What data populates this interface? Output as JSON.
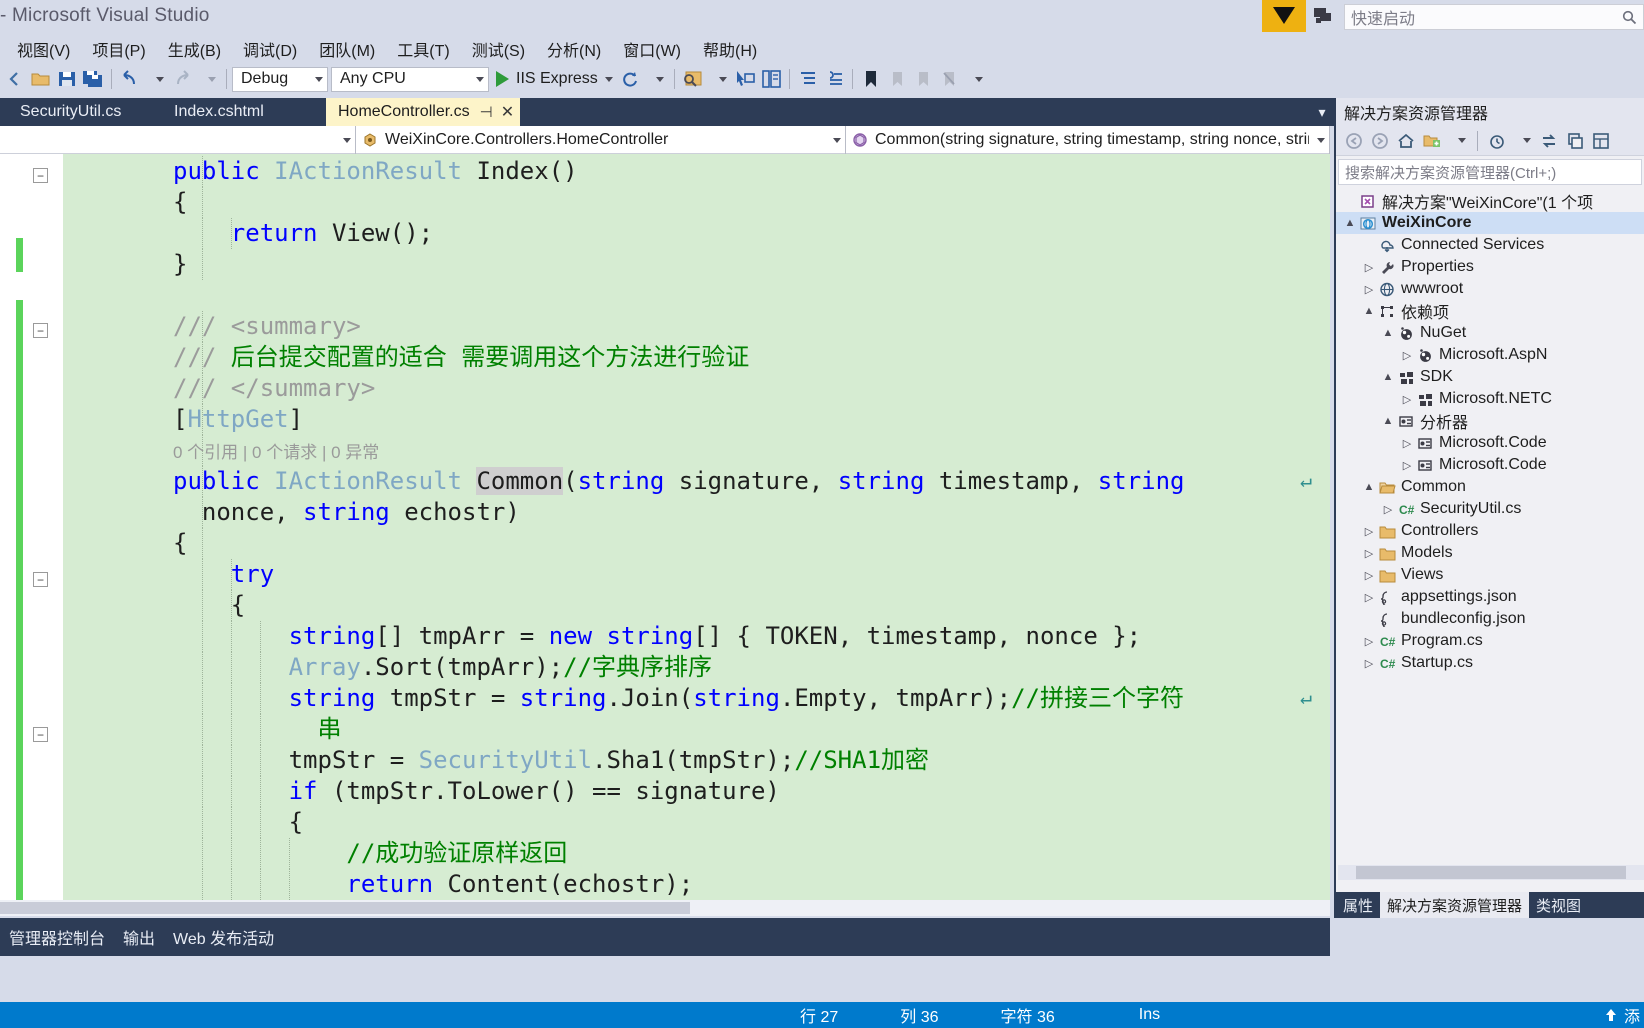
{
  "titlebar": {
    "title": "- Microsoft Visual Studio",
    "feedback_icon": "feedback-funnel-icon",
    "notify_icon": "notification-icon",
    "quick_launch_placeholder": "快速启动",
    "search_icon": "search-icon"
  },
  "menu": {
    "items": [
      {
        "label": "视图(V)"
      },
      {
        "label": "项目(P)"
      },
      {
        "label": "生成(B)"
      },
      {
        "label": "调试(D)"
      },
      {
        "label": "团队(M)"
      },
      {
        "label": "工具(T)"
      },
      {
        "label": "测试(S)"
      },
      {
        "label": "分析(N)"
      },
      {
        "label": "窗口(W)"
      },
      {
        "label": "帮助(H)"
      }
    ]
  },
  "toolbar": {
    "config_value": "Debug",
    "platform_value": "Any CPU",
    "run_label": "IIS Express",
    "icons": [
      "navigate-back-icon",
      "open-folder-icon",
      "save-icon",
      "save-all-icon",
      "undo-icon",
      "redo-icon",
      "refresh-icon",
      "find-icon",
      "folder-search-icon",
      "comment-icon",
      "uncomment-icon",
      "indent-icon",
      "outdent-icon",
      "bookmark-icon",
      "prev-bookmark-icon",
      "next-bookmark-icon",
      "clear-bookmark-icon"
    ]
  },
  "tabs": {
    "items": [
      {
        "label": "SecurityUtil.cs",
        "active": false
      },
      {
        "label": "Index.cshtml",
        "active": false
      },
      {
        "label": "HomeController.cs",
        "active": true
      }
    ],
    "pin_glyph": "⊣",
    "close_glyph": "✕",
    "overflow_glyph": "▾"
  },
  "navbar": {
    "project_value": "",
    "type_value": "WeiXinCore.Controllers.HomeController",
    "member_value": "Common(string signature, string timestamp, string nonce, strin"
  },
  "editor": {
    "lines": [
      {
        "indent": 2,
        "glyph": "-",
        "changed": false,
        "html": "<span class=\"k\">public</span> <span class=\"t\">IActionResult</span> Index()"
      },
      {
        "indent": 2,
        "changed": false,
        "html": "{"
      },
      {
        "indent": 3,
        "changed": false,
        "html": "    <span class=\"k\">return</span> View();"
      },
      {
        "indent": 2,
        "changed": false,
        "html": "}"
      },
      {
        "indent": 0,
        "changed": false,
        "html": ""
      },
      {
        "indent": 2,
        "glyph": "-",
        "changed": false,
        "html": "<span class=\"cg\">/// &lt;summary&gt;</span>"
      },
      {
        "indent": 2,
        "changed": false,
        "html": "<span class=\"cg\">/// </span><span class=\"c\">后台提交配置的适合 需要调用这个方法进行验证</span>"
      },
      {
        "indent": 2,
        "changed": false,
        "html": "<span class=\"cg\">/// &lt;/summary&gt;</span>"
      },
      {
        "indent": 2,
        "changed": false,
        "html": "[<span class=\"t\">HttpGet</span>]"
      },
      {
        "indent": 2,
        "codelens": "0 个引用 | 0 个请求 | 0 异常"
      },
      {
        "indent": 2,
        "changed": true,
        "html": "<span class=\"k\">public</span> <span class=\"t\">IActionResult</span> <span class=\"hl\">Common</span>(<span class=\"k\">string</span> signature, <span class=\"k\">string</span> timestamp, <span class=\"k\">string</span>"
      },
      {
        "indent": 2,
        "changed": true,
        "html": "  nonce, <span class=\"k\">string</span> echostr)"
      },
      {
        "indent": 2,
        "changed": true,
        "html": "{"
      },
      {
        "indent": 3,
        "glyph": "-",
        "changed": true,
        "html": "    <span class=\"k\">try</span>"
      },
      {
        "indent": 3,
        "changed": true,
        "html": "    {"
      },
      {
        "indent": 4,
        "changed": true,
        "html": "        <span class=\"k\">string</span>[] tmpArr = <span class=\"k\">new</span> <span class=\"k\">string</span>[] { TOKEN, timestamp, nonce };"
      },
      {
        "indent": 4,
        "changed": true,
        "html": "        <span class=\"t\">Array</span>.Sort(tmpArr);<span class=\"c\">//字典序排序</span>"
      },
      {
        "indent": 4,
        "changed": true,
        "html": "        <span class=\"k\">string</span> tmpStr = <span class=\"k\">string</span>.Join(<span class=\"k\">string</span>.Empty, tmpArr);<span class=\"c\">//拼接三个字符</span>"
      },
      {
        "indent": 4,
        "changed": true,
        "html": "          <span class=\"c\">串</span>"
      },
      {
        "indent": 4,
        "changed": true,
        "html": "        tmpStr = <span class=\"t\">SecurityUtil</span>.Sha1(tmpStr);<span class=\"c\">//SHA1加密</span>"
      },
      {
        "indent": 4,
        "glyph": "-",
        "changed": true,
        "html": "        <span class=\"k\">if</span> (tmpStr.ToLower() == signature)"
      },
      {
        "indent": 4,
        "changed": true,
        "html": "        {"
      },
      {
        "indent": 5,
        "changed": true,
        "html": "            <span class=\"c\">//成功验证原样返回</span>"
      },
      {
        "indent": 5,
        "changed": true,
        "html": "            <span class=\"k\">return</span> Content(echostr);"
      },
      {
        "indent": 5,
        "changed": true,
        "html": "        "
      }
    ],
    "wrap_arrow": "↵",
    "scroll_up_glyph": "▲",
    "scroll_down_glyph": "▼",
    "splitter_glyph": "⇕"
  },
  "solution_explorer": {
    "title": "解决方案资源管理器",
    "toolbar_icons": [
      "back-icon",
      "forward-icon",
      "home-icon",
      "new-folder-icon",
      "pending-changes-icon",
      "sync-icon",
      "collapse-all-icon",
      "properties-icon"
    ],
    "search_placeholder": "搜索解决方案资源管理器(Ctrl+;)",
    "tree": [
      {
        "level": 0,
        "twisty": "",
        "icon": "solution-icon",
        "label": "解决方案\"WeiXinCore\"(1 个项",
        "bold": false,
        "selected": false
      },
      {
        "level": 0,
        "twisty": "▲",
        "icon": "project-web-icon",
        "label": "WeiXinCore",
        "bold": true,
        "selected": true
      },
      {
        "level": 1,
        "twisty": "",
        "icon": "connected-services-icon",
        "label": "Connected Services",
        "bold": false,
        "selected": false
      },
      {
        "level": 1,
        "twisty": "▷",
        "icon": "properties-wrench-icon",
        "label": "Properties",
        "bold": false,
        "selected": false
      },
      {
        "level": 1,
        "twisty": "▷",
        "icon": "globe-icon",
        "label": "wwwroot",
        "bold": false,
        "selected": false
      },
      {
        "level": 1,
        "twisty": "▲",
        "icon": "dependencies-icon",
        "label": "依赖项",
        "bold": false,
        "selected": false
      },
      {
        "level": 2,
        "twisty": "▲",
        "icon": "nuget-icon",
        "label": "NuGet",
        "bold": false,
        "selected": false
      },
      {
        "level": 3,
        "twisty": "▷",
        "icon": "nuget-icon",
        "label": "Microsoft.AspN",
        "bold": false,
        "selected": false
      },
      {
        "level": 2,
        "twisty": "▲",
        "icon": "sdk-icon",
        "label": "SDK",
        "bold": false,
        "selected": false
      },
      {
        "level": 3,
        "twisty": "▷",
        "icon": "sdk-icon",
        "label": "Microsoft.NETC",
        "bold": false,
        "selected": false
      },
      {
        "level": 2,
        "twisty": "▲",
        "icon": "analyzer-icon",
        "label": "分析器",
        "bold": false,
        "selected": false
      },
      {
        "level": 3,
        "twisty": "▷",
        "icon": "analyzer-icon",
        "label": "Microsoft.Code",
        "bold": false,
        "selected": false
      },
      {
        "level": 3,
        "twisty": "▷",
        "icon": "analyzer-icon",
        "label": "Microsoft.Code",
        "bold": false,
        "selected": false
      },
      {
        "level": 1,
        "twisty": "▲",
        "icon": "folder-open-icon",
        "label": "Common",
        "bold": false,
        "selected": false
      },
      {
        "level": 2,
        "twisty": "▷",
        "icon": "csharp-file-icon",
        "label": "SecurityUtil.cs",
        "bold": false,
        "selected": false
      },
      {
        "level": 1,
        "twisty": "▷",
        "icon": "folder-icon",
        "label": "Controllers",
        "bold": false,
        "selected": false
      },
      {
        "level": 1,
        "twisty": "▷",
        "icon": "folder-icon",
        "label": "Models",
        "bold": false,
        "selected": false
      },
      {
        "level": 1,
        "twisty": "▷",
        "icon": "folder-icon",
        "label": "Views",
        "bold": false,
        "selected": false
      },
      {
        "level": 1,
        "twisty": "▷",
        "icon": "json-file-icon",
        "label": "appsettings.json",
        "bold": false,
        "selected": false
      },
      {
        "level": 1,
        "twisty": "",
        "icon": "json-file-icon",
        "label": "bundleconfig.json",
        "bold": false,
        "selected": false
      },
      {
        "level": 1,
        "twisty": "▷",
        "icon": "csharp-file-icon",
        "label": "Program.cs",
        "bold": false,
        "selected": false
      },
      {
        "level": 1,
        "twisty": "▷",
        "icon": "csharp-file-icon",
        "label": "Startup.cs",
        "bold": false,
        "selected": false
      }
    ],
    "panel_tabs": [
      {
        "label": "属性",
        "active": false
      },
      {
        "label": "解决方案资源管理器",
        "active": true
      },
      {
        "label": "类视图",
        "active": false
      }
    ]
  },
  "bottom_panel": {
    "tabs": [
      {
        "label": "管理器控制台",
        "active": false
      },
      {
        "label": "输出",
        "active": false
      },
      {
        "label": "Web 发布活动",
        "active": false
      }
    ]
  },
  "statusbar": {
    "line_label": "行 27",
    "col_label": "列 36",
    "char_label": "字符 36",
    "insert_mode": "Ins",
    "right_label": "添",
    "upload_icon": "upload-arrow-icon"
  },
  "colors": {
    "accent_blue": "#007acc",
    "chrome": "#d6dbe9",
    "tabstrip_dark": "#2d3c56",
    "active_tab_yellow": "#fdf4c9",
    "code_changed_green": "#d6ecd2",
    "change_bar_green": "#5bd45b",
    "feedback_yellow": "#eeb111"
  }
}
